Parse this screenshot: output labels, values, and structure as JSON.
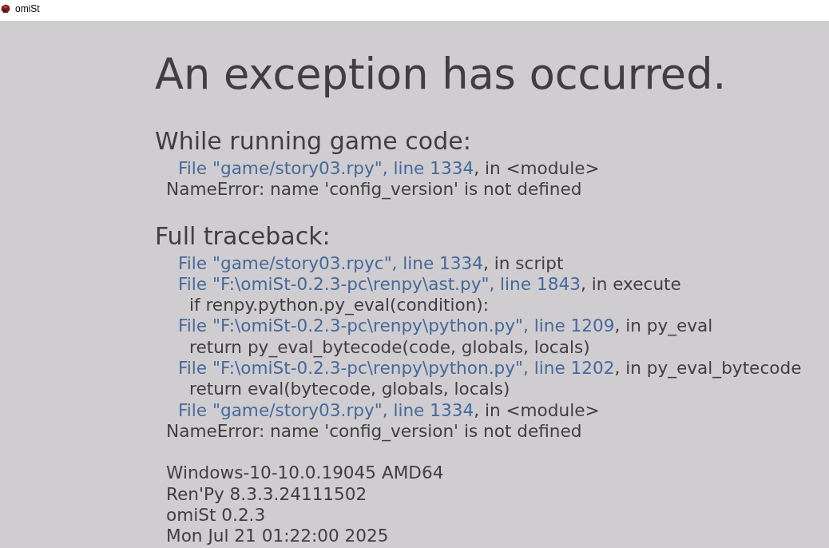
{
  "window": {
    "title": "omiSt"
  },
  "heading": "An exception has occurred.",
  "sections": [
    {
      "title": "While running game code:",
      "lines": [
        {
          "kind": "frame",
          "location": "File \"game/story03.rpy\", line 1334",
          "context": ", in <module>"
        },
        {
          "kind": "error",
          "text": "NameError: name 'config_version' is not defined"
        }
      ]
    },
    {
      "title": "Full traceback:",
      "lines": [
        {
          "kind": "frame",
          "location": "File \"game/story03.rpyc\", line 1334",
          "context": ", in script"
        },
        {
          "kind": "frame",
          "location": "File \"F:\\omiSt-0.2.3-pc\\renpy\\ast.py\", line 1843",
          "context": ", in execute"
        },
        {
          "kind": "code",
          "text": "if renpy.python.py_eval(condition):"
        },
        {
          "kind": "frame",
          "location": "File \"F:\\omiSt-0.2.3-pc\\renpy\\python.py\", line 1209",
          "context": ", in py_eval"
        },
        {
          "kind": "code",
          "text": "return py_eval_bytecode(code, globals, locals)"
        },
        {
          "kind": "frame",
          "location": "File \"F:\\omiSt-0.2.3-pc\\renpy\\python.py\", line 1202",
          "context": ", in py_eval_bytecode"
        },
        {
          "kind": "code",
          "text": "return eval(bytecode, globals, locals)"
        },
        {
          "kind": "frame",
          "location": "File \"game/story03.rpy\", line 1334",
          "context": ", in <module>"
        },
        {
          "kind": "error",
          "text": "NameError: name 'config_version' is not defined"
        }
      ]
    }
  ],
  "system_info": [
    "Windows-10-10.0.19045 AMD64",
    "Ren'Py 8.3.3.24111502",
    "omiSt 0.2.3",
    "Mon Jul 21 01:22:00 2025"
  ]
}
